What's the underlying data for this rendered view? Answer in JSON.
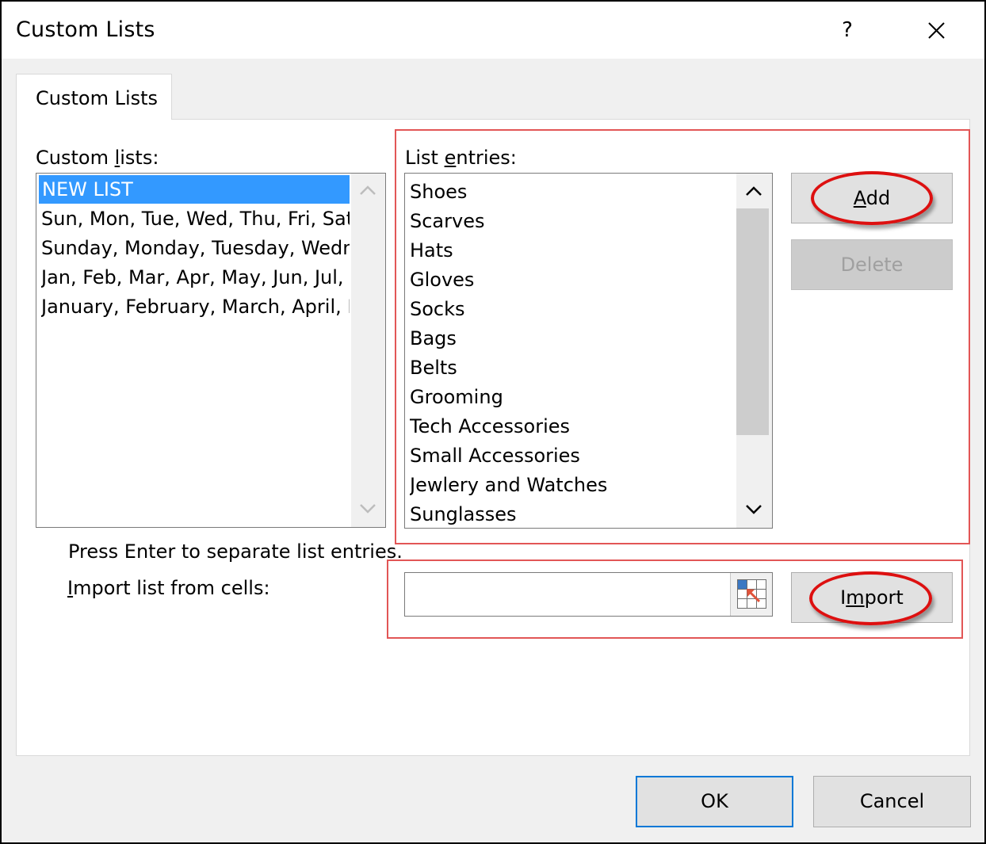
{
  "window": {
    "title": "Custom Lists",
    "help_label": "?",
    "close_icon": "close-icon"
  },
  "tabs": [
    {
      "label": "Custom Lists",
      "active": true
    }
  ],
  "custom_lists": {
    "label_pre": "Custom ",
    "label_accel": "l",
    "label_post": "ists:",
    "items": [
      "NEW LIST",
      "Sun, Mon, Tue, Wed, Thu, Fri, Sat",
      "Sunday, Monday, Tuesday, Wednesday, Thursday, Friday, Saturday",
      "Jan, Feb, Mar, Apr, May, Jun, Jul, Aug, Sep, Oct, Nov, Dec",
      "January, February, March, April, May, June, July, August, September, October, November, December"
    ],
    "selected_index": 0
  },
  "list_entries": {
    "label_pre": "List ",
    "label_accel": "e",
    "label_post": "ntries:",
    "items": [
      "Shoes",
      "Scarves",
      "Hats",
      "Gloves",
      "Socks",
      "Bags",
      "Belts",
      "Grooming",
      "Tech Accessories",
      "Small Accessories",
      "Jewlery and Watches",
      "Sunglasses"
    ]
  },
  "buttons": {
    "add": {
      "accel": "A",
      "rest": "dd"
    },
    "delete": {
      "label": "Delete",
      "enabled": false
    },
    "import": {
      "pre": "I",
      "accel": "m",
      "post": "port"
    },
    "ok": "OK",
    "cancel": "Cancel"
  },
  "hint_text": "Press Enter to separate list entries.",
  "import_label": {
    "accel": "I",
    "rest": "mport list from cells:"
  },
  "import_input": {
    "value": "",
    "picker_icon": "range-select-icon"
  },
  "colors": {
    "selection": "#3399ff",
    "annotation_box": "#e25656",
    "annotation_oval": "#dd1010",
    "default_button_border": "#0078d7"
  }
}
